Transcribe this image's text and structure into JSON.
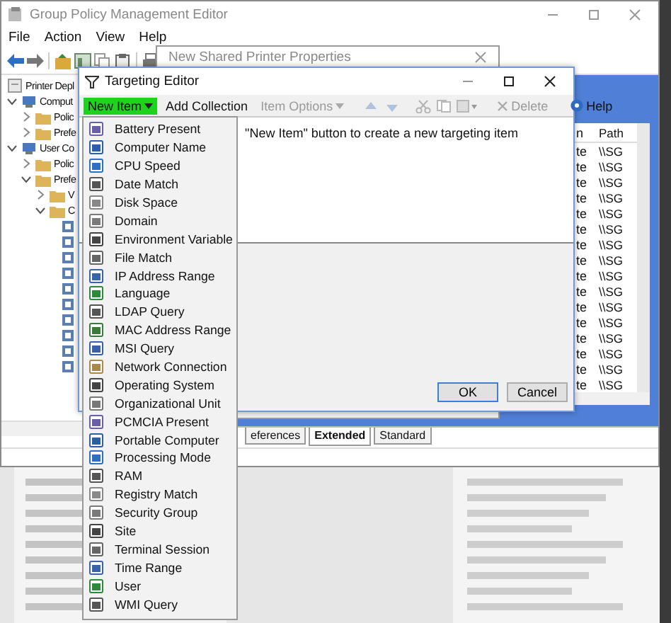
{
  "main_window": {
    "title": "Group Policy Management Editor",
    "menu": [
      "File",
      "Action",
      "View",
      "Help"
    ],
    "toolbar": [
      {
        "kind": "back"
      },
      {
        "kind": "forward"
      },
      {
        "kind": "folder-up"
      },
      {
        "kind": "panel"
      },
      {
        "kind": "copy"
      },
      {
        "kind": "paste"
      },
      {
        "kind": "printer"
      }
    ],
    "tree": [
      {
        "label": "Printer Depl",
        "children": [
          {
            "label": "Comput",
            "expanded": true,
            "children": [
              {
                "label": "Polic",
                "expanded": false
              },
              {
                "label": "Prefe",
                "expanded": false
              }
            ]
          },
          {
            "label": "User Co",
            "expanded": true,
            "children": [
              {
                "label": "Polic",
                "expanded": false
              },
              {
                "label": "Prefe",
                "expanded": true,
                "children": [
                  {
                    "label": "V",
                    "expanded": false
                  },
                  {
                    "label": "C",
                    "expanded": true,
                    "children": [
                      {
                        "kind": "leaf"
                      },
                      {
                        "kind": "leaf"
                      },
                      {
                        "kind": "leaf"
                      },
                      {
                        "kind": "leaf"
                      },
                      {
                        "kind": "leaf"
                      },
                      {
                        "kind": "leaf"
                      },
                      {
                        "kind": "leaf"
                      },
                      {
                        "kind": "leaf"
                      },
                      {
                        "kind": "leaf"
                      },
                      {
                        "kind": "leaf"
                      }
                    ]
                  }
                ]
              }
            ]
          }
        ]
      }
    ],
    "list": {
      "columns": [
        "n",
        "Path"
      ],
      "rows": [
        {
          "column_1": "te",
          "path": "\\\\SG"
        },
        {
          "column_1": "te",
          "path": "\\\\SG"
        },
        {
          "column_1": "te",
          "path": "\\\\SG"
        },
        {
          "column_1": "te",
          "path": "\\\\SG"
        },
        {
          "column_1": "te",
          "path": "\\\\SG"
        },
        {
          "column_1": "te",
          "path": "\\\\SG"
        },
        {
          "column_1": "te",
          "path": "\\\\SG"
        },
        {
          "column_1": "te",
          "path": "\\\\SG"
        },
        {
          "column_1": "te",
          "path": "\\\\SG"
        },
        {
          "column_1": "te",
          "path": "\\\\SG"
        },
        {
          "column_1": "te",
          "path": "\\\\SG"
        },
        {
          "column_1": "te",
          "path": "\\\\SG"
        },
        {
          "column_1": "te",
          "path": "\\\\SG"
        },
        {
          "column_1": "te",
          "path": "\\\\SG"
        },
        {
          "column_1": "te",
          "path": "\\\\SG"
        },
        {
          "column_1": "te",
          "path": "\\\\SG"
        }
      ]
    },
    "tabs": [
      {
        "label": "eferences",
        "selected": false
      },
      {
        "label": "Extended",
        "selected": true
      },
      {
        "label": "Standard",
        "selected": false
      }
    ]
  },
  "properties_window": {
    "title": "New Shared Printer Properties"
  },
  "targeting_editor": {
    "title": "Targeting Editor",
    "toolbar": [
      {
        "kind": "menu",
        "label": "New Item",
        "disabled": false,
        "highlighted": true
      },
      {
        "kind": "text",
        "label": "Add Collection",
        "disabled": false,
        "highlighted": false
      },
      {
        "kind": "menu",
        "label": "Item Options",
        "disabled": true,
        "highlighted": false
      },
      {
        "kind": "move-up",
        "disabled": true,
        "highlighted": false
      },
      {
        "kind": "move-down",
        "disabled": true,
        "highlighted": false
      },
      {
        "kind": "cut",
        "disabled": true,
        "highlighted": false
      },
      {
        "kind": "copy",
        "disabled": true,
        "highlighted": false
      },
      {
        "kind": "paste",
        "disabled": true,
        "highlighted": false
      },
      {
        "kind": "delete",
        "label": "Delete",
        "disabled": true,
        "highlighted": false
      },
      {
        "kind": "help",
        "label": "Help",
        "disabled": false,
        "highlighted": false
      }
    ],
    "hint": "\"New Item\" button to create a new targeting item",
    "buttons": [
      {
        "label": "OK",
        "default": true
      },
      {
        "label": "Cancel",
        "default": false
      }
    ]
  },
  "new_item_menu": [
    "Battery Present",
    "Computer Name",
    "CPU Speed",
    "Date Match",
    "Disk Space",
    "Domain",
    "Environment Variable",
    "File Match",
    "IP Address Range",
    "Language",
    "LDAP Query",
    "MAC Address Range",
    "MSI Query",
    "Network Connection",
    "Operating System",
    "Organizational Unit",
    "PCMCIA Present",
    "Portable Computer",
    "Processing Mode",
    "RAM",
    "Registry Match",
    "Security Group",
    "Site",
    "Terminal Session",
    "Time Range",
    "User",
    "WMI Query"
  ]
}
